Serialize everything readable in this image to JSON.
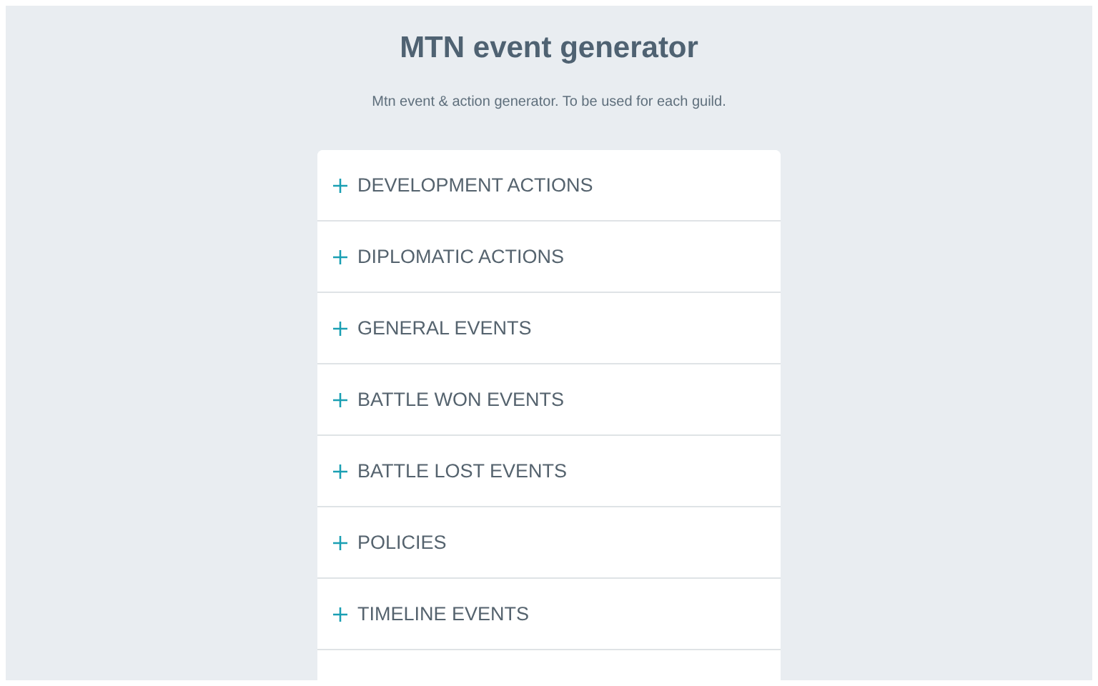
{
  "title": "MTN event generator",
  "subtitle": "Mtn event & action generator. To be used for each guild.",
  "sections": [
    {
      "label": "DEVELOPMENT ACTIONS",
      "expanded": false
    },
    {
      "label": "DIPLOMATIC ACTIONS",
      "expanded": false
    },
    {
      "label": "GENERAL EVENTS",
      "expanded": false
    },
    {
      "label": "BATTLE WON EVENTS",
      "expanded": false
    },
    {
      "label": "BATTLE LOST EVENTS",
      "expanded": false
    },
    {
      "label": "POLICIES",
      "expanded": false
    },
    {
      "label": "TIMELINE EVENTS",
      "expanded": false
    }
  ]
}
